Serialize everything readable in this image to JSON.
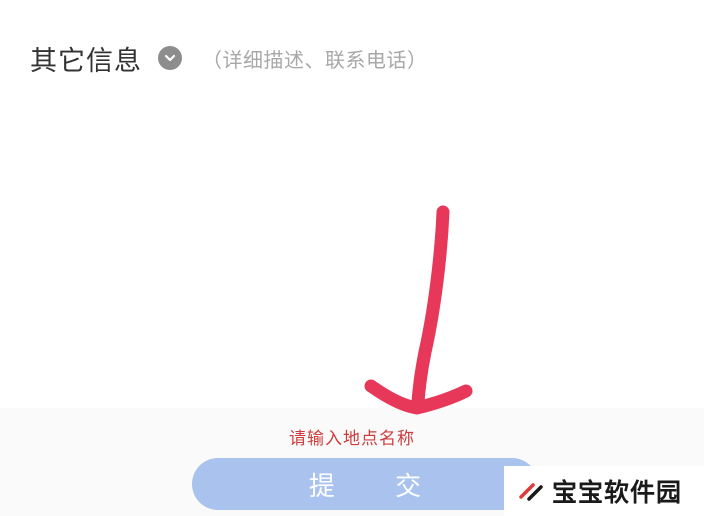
{
  "section": {
    "title": "其它信息",
    "hint": "（详细描述、联系电话）",
    "expand_icon": "chevron-down-icon"
  },
  "form": {
    "validation_message": "请输入地点名称",
    "submit_label": "提 交"
  },
  "annotation": {
    "arrow_color": "#e8385a",
    "arrow_icon": "hand-drawn-arrow-down"
  },
  "watermark": {
    "text": "宝宝软件园",
    "logo_icon": "double-slash-logo-icon"
  },
  "colors": {
    "submit_button_bg": "#a9c3ee",
    "error_text": "#cf3b3b"
  }
}
